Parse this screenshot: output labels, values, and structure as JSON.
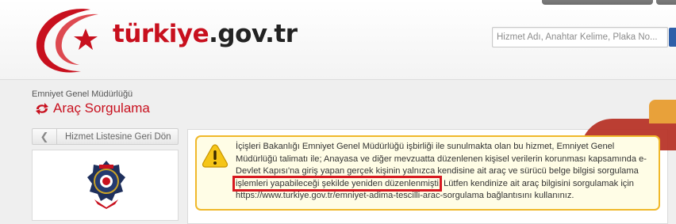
{
  "header": {
    "logo_text_prefix": "türkiye",
    "logo_text_suffix": ".gov.tr",
    "search": {
      "placeholder": "Hizmet Adı, Anahtar Kelime, Plaka No..."
    }
  },
  "breadcrumb": "Emniyet Genel Müdürlüğü",
  "page_title": "Araç Sorgulama",
  "sidebar": {
    "back_label": "Hizmet Listesine Geri Dön"
  },
  "notice": {
    "text_before": "İçişleri Bakanlığı Emniyet Genel Müdürlüğü işbirliği ile sunulmakta olan bu hizmet, Emniyet Genel Müdürlüğü talimatı ile; Anayasa ve diğer mevzuatta düzenlenen kişisel verilerin korunması kapsamında e-Devlet Kapısı'na giriş yapan gerçek kişinin yalnızca kendisine ait araç ve sürücü belge bilgisi sorgulama ",
    "highlighted": "işlemleri yapabileceği şekilde yeniden düzenlenmişti",
    "text_after": ". Lütfen kendinize ait araç bilgisini sorgulamak için https://www.turkiye.gov.tr/emniyet-adima-tescilli-arac-sorgulama bağlantısını kullanınız."
  },
  "colors": {
    "brand_red": "#c8101e",
    "warning_border": "#f0b82a",
    "highlight": "#d71920"
  }
}
